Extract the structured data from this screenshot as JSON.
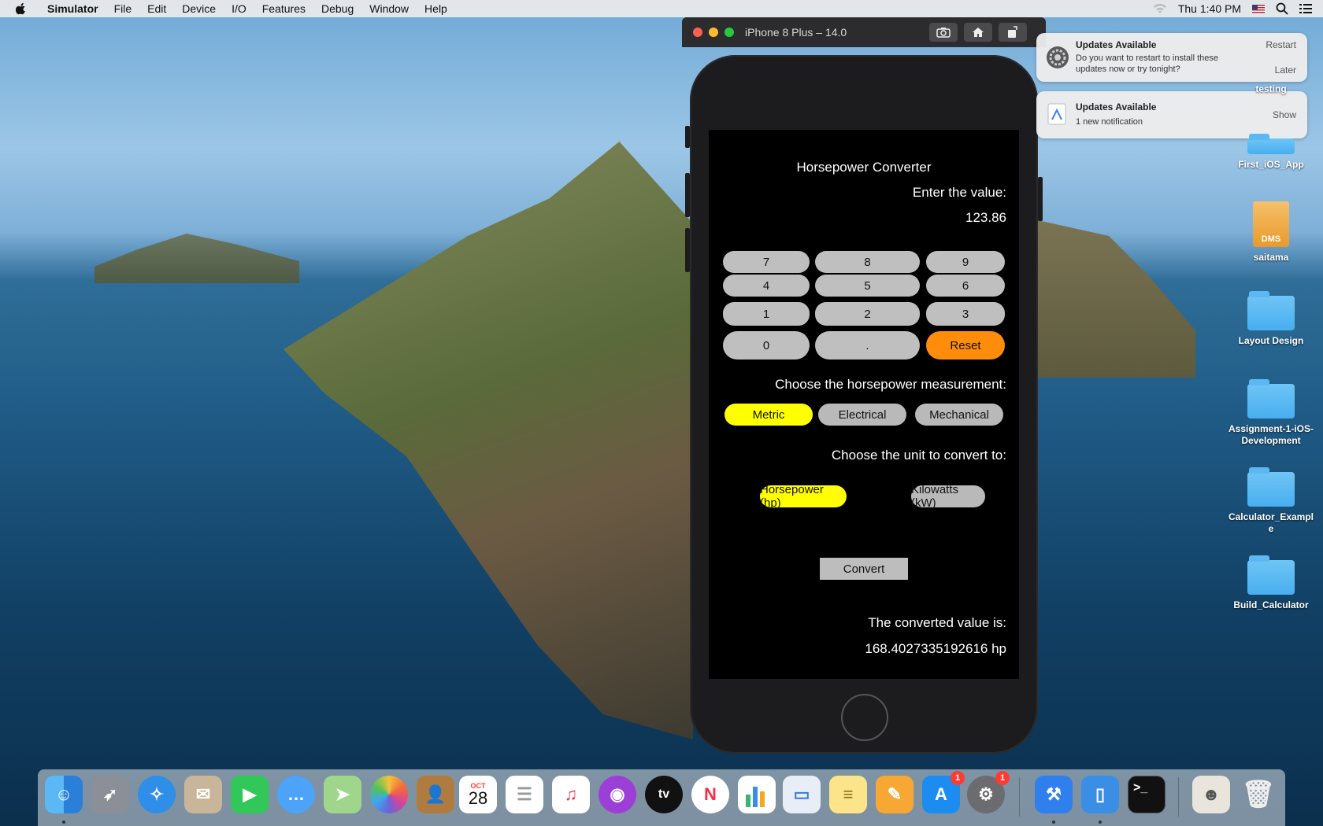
{
  "menubar": {
    "app": "Simulator",
    "items": [
      "File",
      "Edit",
      "Device",
      "I/O",
      "Features",
      "Debug",
      "Window",
      "Help"
    ],
    "clock": "Thu 1:40 PM"
  },
  "simulator": {
    "window_title": "iPhone 8 Plus – 14.0"
  },
  "app": {
    "title": "Horsepower Converter",
    "enter_label": "Enter the value:",
    "input_value": "123.86",
    "keys": [
      "7",
      "8",
      "9",
      "4",
      "5",
      "6",
      "1",
      "2",
      "3",
      "0",
      ".",
      "Reset"
    ],
    "measurement_label": "Choose the horsepower measurement:",
    "measurements": [
      "Metric",
      "Electrical",
      "Mechanical"
    ],
    "selected_measurement": "Metric",
    "unit_label": "Choose the unit to convert to:",
    "units": [
      "Horsepower (hp)",
      "Kilowatts (kW)"
    ],
    "selected_unit": "Horsepower (hp)",
    "convert_label": "Convert",
    "result_label": "The converted value is:",
    "result_value": "168.4027335192616 hp"
  },
  "notifications": [
    {
      "title": "Updates Available",
      "body": "Do you want to restart to install these updates now or try tonight?",
      "actions": [
        "Restart",
        "Later"
      ]
    },
    {
      "title": "Updates Available",
      "body": "1 new notification",
      "actions": [
        "Show"
      ]
    }
  ],
  "desktop_icons": [
    {
      "label": "testing"
    },
    {
      "label": "First_iOS_App"
    },
    {
      "label": "saitama",
      "badge": "DMS"
    },
    {
      "label": "Layout Design"
    },
    {
      "label": "Assignment-1-iOS-Development"
    },
    {
      "label": "Calculator_Example"
    },
    {
      "label": "Build_Calculator"
    }
  ],
  "dock": {
    "calendar_month": "OCT",
    "calendar_day": "28",
    "badges": {
      "app_store": "1",
      "system_preferences": "1"
    },
    "tv_label": "tv"
  },
  "colors": {
    "selected": "#ffff00",
    "reset": "#ff8c0a",
    "key": "#bfbfbf"
  }
}
